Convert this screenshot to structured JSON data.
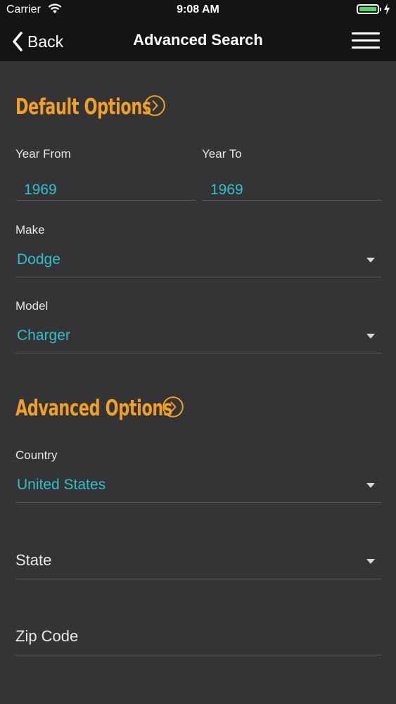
{
  "status_bar": {
    "carrier": "Carrier",
    "time": "9:08 AM"
  },
  "nav": {
    "back_label": "Back",
    "title": "Advanced Search"
  },
  "default_options": {
    "title": "Default Options",
    "year_from": {
      "label": "Year From",
      "value": "1969"
    },
    "year_to": {
      "label": "Year To",
      "value": "1969"
    },
    "make": {
      "label": "Make",
      "value": "Dodge"
    },
    "model": {
      "label": "Model",
      "value": "Charger"
    }
  },
  "advanced_options": {
    "title": "Advanced Options",
    "country": {
      "label": "Country",
      "value": "United States"
    },
    "state": {
      "placeholder": "State"
    },
    "zip": {
      "placeholder": "Zip Code"
    }
  },
  "colors": {
    "accent": "#f0a124",
    "value_text": "#2cc2c6",
    "background": "#343335",
    "nav_bar": "#141414",
    "battery": "#4cd964"
  },
  "icons": [
    "wifi-icon",
    "battery-icon",
    "charging-bolt-icon",
    "back-chevron-icon",
    "hamburger-menu-icon",
    "expand-circle-icon",
    "dropdown-caret-icon"
  ]
}
